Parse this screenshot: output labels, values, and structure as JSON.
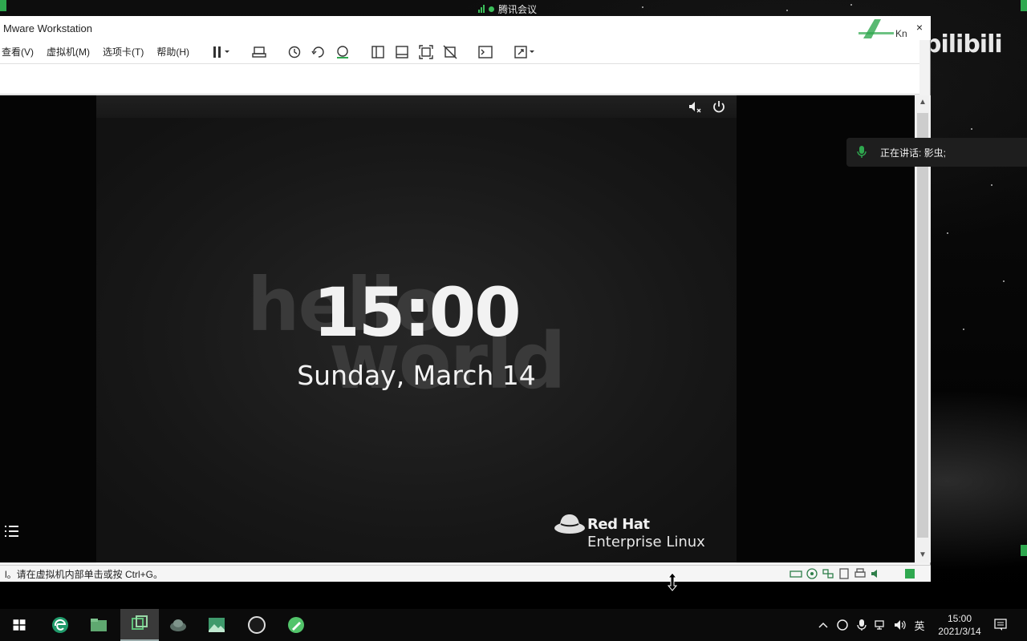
{
  "desktop": {
    "bili_logo": "bilibili",
    "tencent_meeting": "腾讯会议"
  },
  "window": {
    "title": "Mware Workstation",
    "close_glyph": "×"
  },
  "menubar": {
    "items": [
      {
        "label": "查看(V)"
      },
      {
        "label": "虚拟机(M)"
      },
      {
        "label": "选项卡(T)"
      },
      {
        "label": "帮助(H)"
      }
    ]
  },
  "toolbar": {
    "icons": [
      "pause-icon",
      "send-ctrl-alt-del-icon",
      "snapshot-icon",
      "revert-snapshot-icon",
      "snapshot-manager-icon",
      "show-library-icon",
      "thumbnail-bar-icon",
      "full-screen-icon",
      "unity-icon",
      "console-icon",
      "stretch-guest-icon"
    ]
  },
  "guest": {
    "clock_time": "15:00",
    "clock_date": "Sunday, March 14",
    "bg_word_1": "hello",
    "bg_word_2": "world",
    "brand_name": "Red Hat",
    "brand_product": "Enterprise Linux"
  },
  "statusbar": {
    "text": "l。请在虚拟机内部单击或按 Ctrl+G。"
  },
  "speaking": {
    "label": "正在讲话: 影虫;"
  },
  "taskbar": {
    "apps": [
      "windows-start-icon",
      "edge-icon",
      "file-explorer-icon",
      "vmware-icon",
      "tencent-icon",
      "photos-icon",
      "obs-icon",
      "whiteboard-icon"
    ],
    "ime": "英",
    "time": "15:00",
    "date": "2021/3/14"
  },
  "colors": {
    "accent_green": "#2fa84f",
    "redhat_red": "#ee0000"
  }
}
